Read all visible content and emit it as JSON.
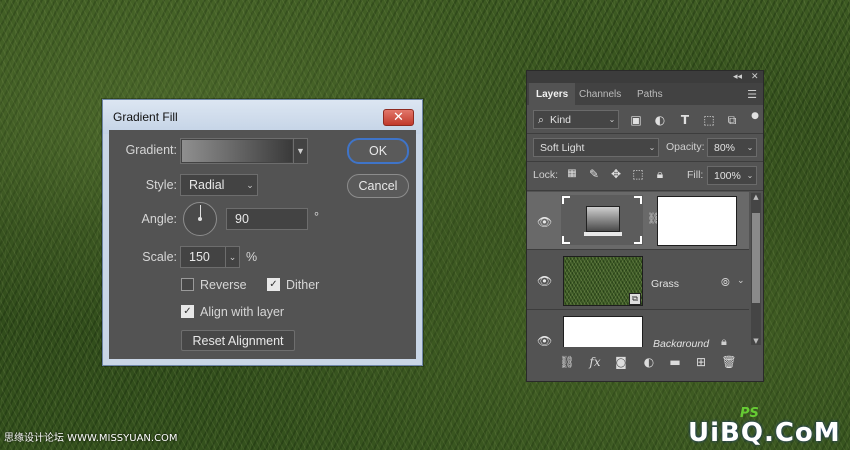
{
  "dialog": {
    "title": "Gradient Fill",
    "close_label": "✕",
    "gradient_label": "Gradient:",
    "style_label": "Style:",
    "style_value": "Radial",
    "angle_label": "Angle:",
    "angle_value": "90",
    "degree_symbol": "°",
    "scale_label": "Scale:",
    "scale_value": "150",
    "percent_symbol": "%",
    "reverse_label": "Reverse",
    "reverse_checked": false,
    "dither_label": "Dither",
    "dither_checked": true,
    "align_label": "Align with layer",
    "align_checked": true,
    "reset_label": "Reset Alignment",
    "ok_label": "OK",
    "cancel_label": "Cancel"
  },
  "layers_panel": {
    "tabs": [
      {
        "label": "Layers",
        "active": true
      },
      {
        "label": "Channels",
        "active": false
      },
      {
        "label": "Paths",
        "active": false
      }
    ],
    "kind_label": "Kind",
    "blend_mode": "Soft Light",
    "opacity_label": "Opacity:",
    "opacity_value": "80%",
    "lock_label": "Lock:",
    "fill_label": "Fill:",
    "fill_value": "100%",
    "layers": [
      {
        "name": "",
        "type": "gradient-fill",
        "selected": true
      },
      {
        "name": "Grass",
        "type": "image",
        "selected": false
      },
      {
        "name": "Background",
        "type": "background",
        "selected": false
      }
    ]
  },
  "watermarks": {
    "left": "思缘设计论坛 WWW.MISSYUAN.COM",
    "ps_logo": "PS",
    "right": "UiBQ.CoM"
  },
  "colors": {
    "dialog_bg": "#535353",
    "titlebar": "#c9d6e6",
    "ok_border": "#3f74c8",
    "close_red": "#c0392b"
  }
}
